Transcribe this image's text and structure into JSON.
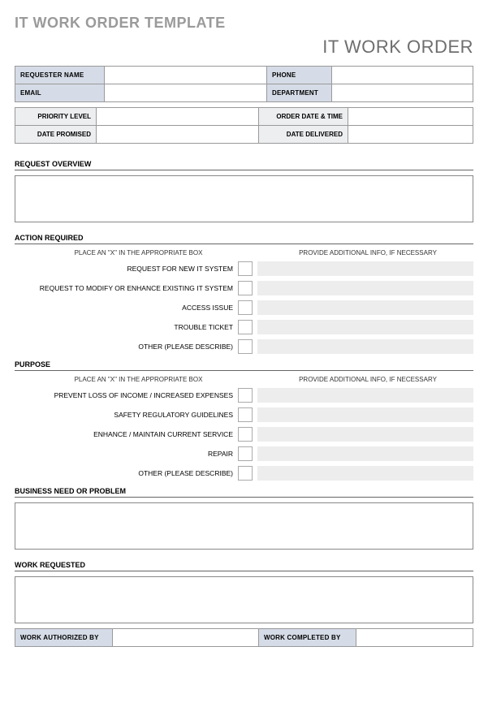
{
  "page_title": "IT WORK ORDER TEMPLATE",
  "doc_title": "IT WORK ORDER",
  "requester": {
    "name_label": "REQUESTER NAME",
    "phone_label": "PHONE",
    "email_label": "EMAIL",
    "department_label": "DEPARTMENT",
    "name": "",
    "phone": "",
    "email": "",
    "department": ""
  },
  "meta": {
    "priority_level_label": "PRIORITY LEVEL",
    "order_date_time_label": "ORDER DATE & TIME",
    "date_promised_label": "DATE PROMISED",
    "date_delivered_label": "DATE DELIVERED",
    "priority_level": "",
    "order_date_time": "",
    "date_promised": "",
    "date_delivered": ""
  },
  "sections": {
    "request_overview": "REQUEST OVERVIEW",
    "action_required": "ACTION REQUIRED",
    "purpose": "PURPOSE",
    "business_need": "BUSINESS NEED OR PROBLEM",
    "work_requested": "WORK REQUESTED"
  },
  "subheads": {
    "place_x": "PLACE AN \"X\" IN THE APPROPRIATE BOX",
    "additional_info": "PROVIDE ADDITIONAL INFO, IF NECESSARY"
  },
  "action_items": {
    "0": "REQUEST FOR NEW IT SYSTEM",
    "1": "REQUEST TO MODIFY OR ENHANCE EXISTING IT SYSTEM",
    "2": "ACCESS ISSUE",
    "3": "TROUBLE TICKET",
    "4": "OTHER (PLEASE DESCRIBE)"
  },
  "purpose_items": {
    "0": "PREVENT LOSS OF INCOME / INCREASED EXPENSES",
    "1": "SAFETY REGULATORY GUIDELINES",
    "2": "ENHANCE / MAINTAIN CURRENT SERVICE",
    "3": "REPAIR",
    "4": "OTHER (PLEASE DESCRIBE)"
  },
  "signoff": {
    "authorized_label": "WORK AUTHORIZED BY",
    "completed_label": "WORK COMPLETED BY",
    "authorized": "",
    "completed": ""
  }
}
